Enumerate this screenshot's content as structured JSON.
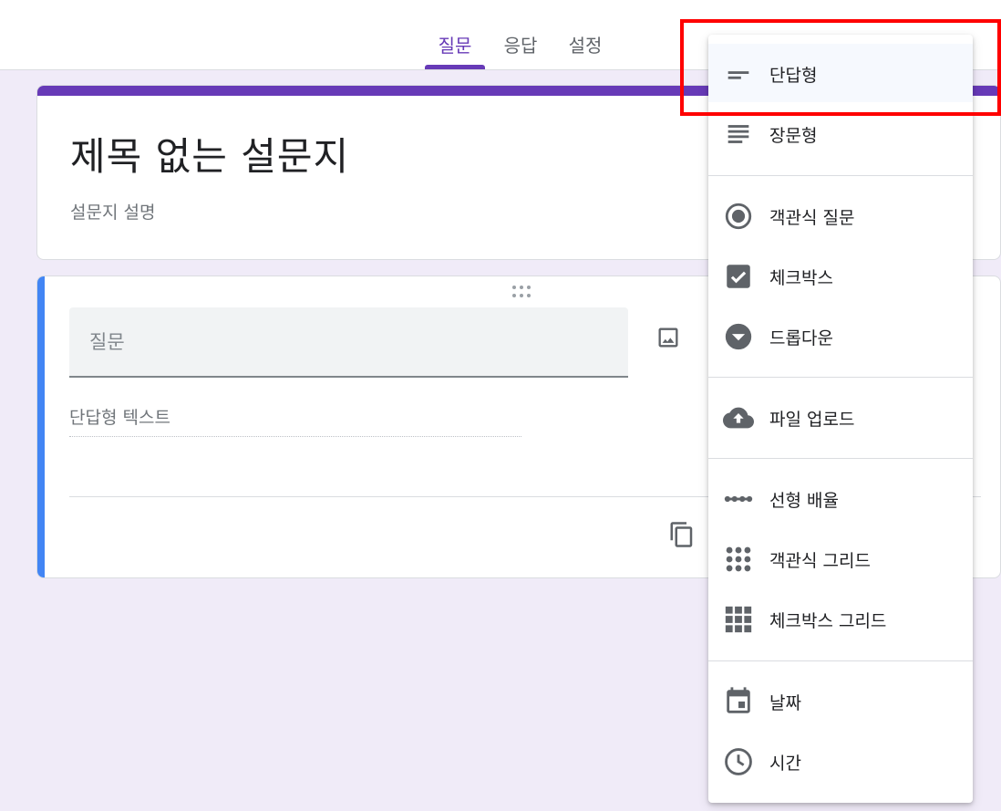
{
  "tabs": [
    {
      "label": "질문"
    },
    {
      "label": "응답"
    },
    {
      "label": "설정"
    }
  ],
  "form": {
    "title": "제목 없는 설문지",
    "description": "설문지 설명"
  },
  "question": {
    "placeholder": "질문",
    "answer_hint": "단답형 텍스트"
  },
  "menu": {
    "items": [
      {
        "label": "단답형",
        "icon": "short-text-icon",
        "selected": true
      },
      {
        "label": "장문형",
        "icon": "paragraph-icon"
      },
      {
        "label": "객관식 질문",
        "icon": "radio-button-icon"
      },
      {
        "label": "체크박스",
        "icon": "checkbox-icon"
      },
      {
        "label": "드롭다운",
        "icon": "dropdown-icon"
      },
      {
        "label": "파일 업로드",
        "icon": "cloud-upload-icon"
      },
      {
        "label": "선형 배율",
        "icon": "linear-scale-icon"
      },
      {
        "label": "객관식 그리드",
        "icon": "dot-grid-icon"
      },
      {
        "label": "체크박스 그리드",
        "icon": "checkbox-grid-icon"
      },
      {
        "label": "날짜",
        "icon": "calendar-icon"
      },
      {
        "label": "시간",
        "icon": "clock-icon"
      }
    ]
  },
  "colors": {
    "accent": "#673ab7",
    "question_bar": "#4285f4",
    "background": "#f0ebf8",
    "highlight": "#ff0000"
  }
}
